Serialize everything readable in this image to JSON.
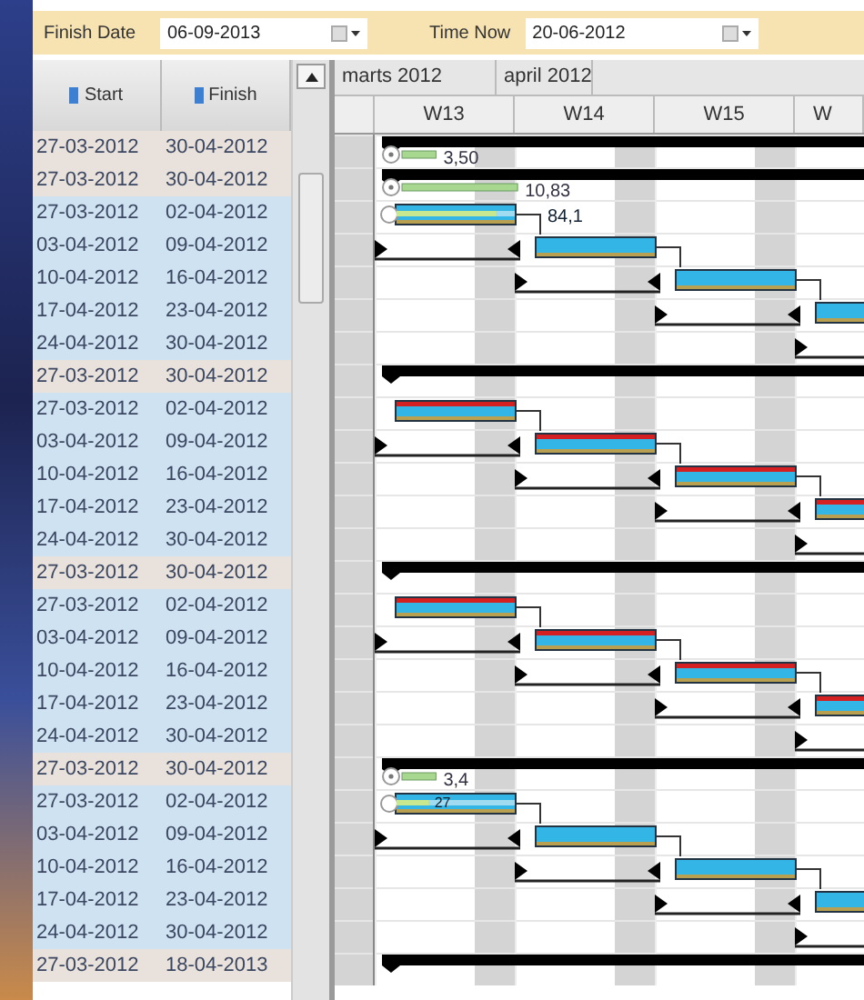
{
  "toolbar": {
    "finish_date": {
      "label": "Finish Date",
      "value": "06-09-2013"
    },
    "time_now": {
      "label": "Time Now",
      "value": "20-06-2012"
    }
  },
  "grid": {
    "columns": [
      "Start",
      "Finish"
    ]
  },
  "timeline": {
    "months": [
      "marts 2012",
      "april 2012"
    ],
    "weeks": [
      "W13",
      "W14",
      "W15",
      "W"
    ]
  },
  "rows": [
    {
      "start": "27-03-2012",
      "finish": "30-04-2012",
      "kind": "summary",
      "progress": {
        "level": 0.05,
        "label": "3,50"
      }
    },
    {
      "start": "27-03-2012",
      "finish": "30-04-2012",
      "kind": "summary",
      "progress": {
        "level": 0.17,
        "label": "10,83"
      }
    },
    {
      "start": "27-03-2012",
      "finish": "02-04-2012",
      "kind": "task",
      "critical": false,
      "progress": {
        "level": 0.84,
        "label": "84,1"
      }
    },
    {
      "start": "03-04-2012",
      "finish": "09-04-2012",
      "kind": "task",
      "critical": false
    },
    {
      "start": "10-04-2012",
      "finish": "16-04-2012",
      "kind": "task",
      "critical": false
    },
    {
      "start": "17-04-2012",
      "finish": "23-04-2012",
      "kind": "task",
      "critical": false
    },
    {
      "start": "24-04-2012",
      "finish": "30-04-2012",
      "kind": "task"
    },
    {
      "start": "27-03-2012",
      "finish": "30-04-2012",
      "kind": "summary"
    },
    {
      "start": "27-03-2012",
      "finish": "02-04-2012",
      "kind": "task",
      "critical": true
    },
    {
      "start": "03-04-2012",
      "finish": "09-04-2012",
      "kind": "task",
      "critical": true
    },
    {
      "start": "10-04-2012",
      "finish": "16-04-2012",
      "kind": "task",
      "critical": true
    },
    {
      "start": "17-04-2012",
      "finish": "23-04-2012",
      "kind": "task",
      "critical": true
    },
    {
      "start": "24-04-2012",
      "finish": "30-04-2012",
      "kind": "task"
    },
    {
      "start": "27-03-2012",
      "finish": "30-04-2012",
      "kind": "summary"
    },
    {
      "start": "27-03-2012",
      "finish": "02-04-2012",
      "kind": "task",
      "critical": true
    },
    {
      "start": "03-04-2012",
      "finish": "09-04-2012",
      "kind": "task",
      "critical": true
    },
    {
      "start": "10-04-2012",
      "finish": "16-04-2012",
      "kind": "task",
      "critical": true
    },
    {
      "start": "17-04-2012",
      "finish": "23-04-2012",
      "kind": "task",
      "critical": true
    },
    {
      "start": "24-04-2012",
      "finish": "30-04-2012",
      "kind": "task"
    },
    {
      "start": "27-03-2012",
      "finish": "30-04-2012",
      "kind": "summary",
      "progress": {
        "level": 0.05,
        "label": "3,4"
      }
    },
    {
      "start": "27-03-2012",
      "finish": "02-04-2012",
      "kind": "task",
      "critical": false,
      "progress": {
        "level": 0.27,
        "label": "27"
      }
    },
    {
      "start": "03-04-2012",
      "finish": "09-04-2012",
      "kind": "task",
      "critical": false
    },
    {
      "start": "10-04-2012",
      "finish": "16-04-2012",
      "kind": "task",
      "critical": false
    },
    {
      "start": "17-04-2012",
      "finish": "23-04-2012",
      "kind": "task",
      "critical": false
    },
    {
      "start": "24-04-2012",
      "finish": "30-04-2012",
      "kind": "task"
    },
    {
      "start": "27-03-2012",
      "finish": "18-04-2013",
      "kind": "summary"
    }
  ]
}
